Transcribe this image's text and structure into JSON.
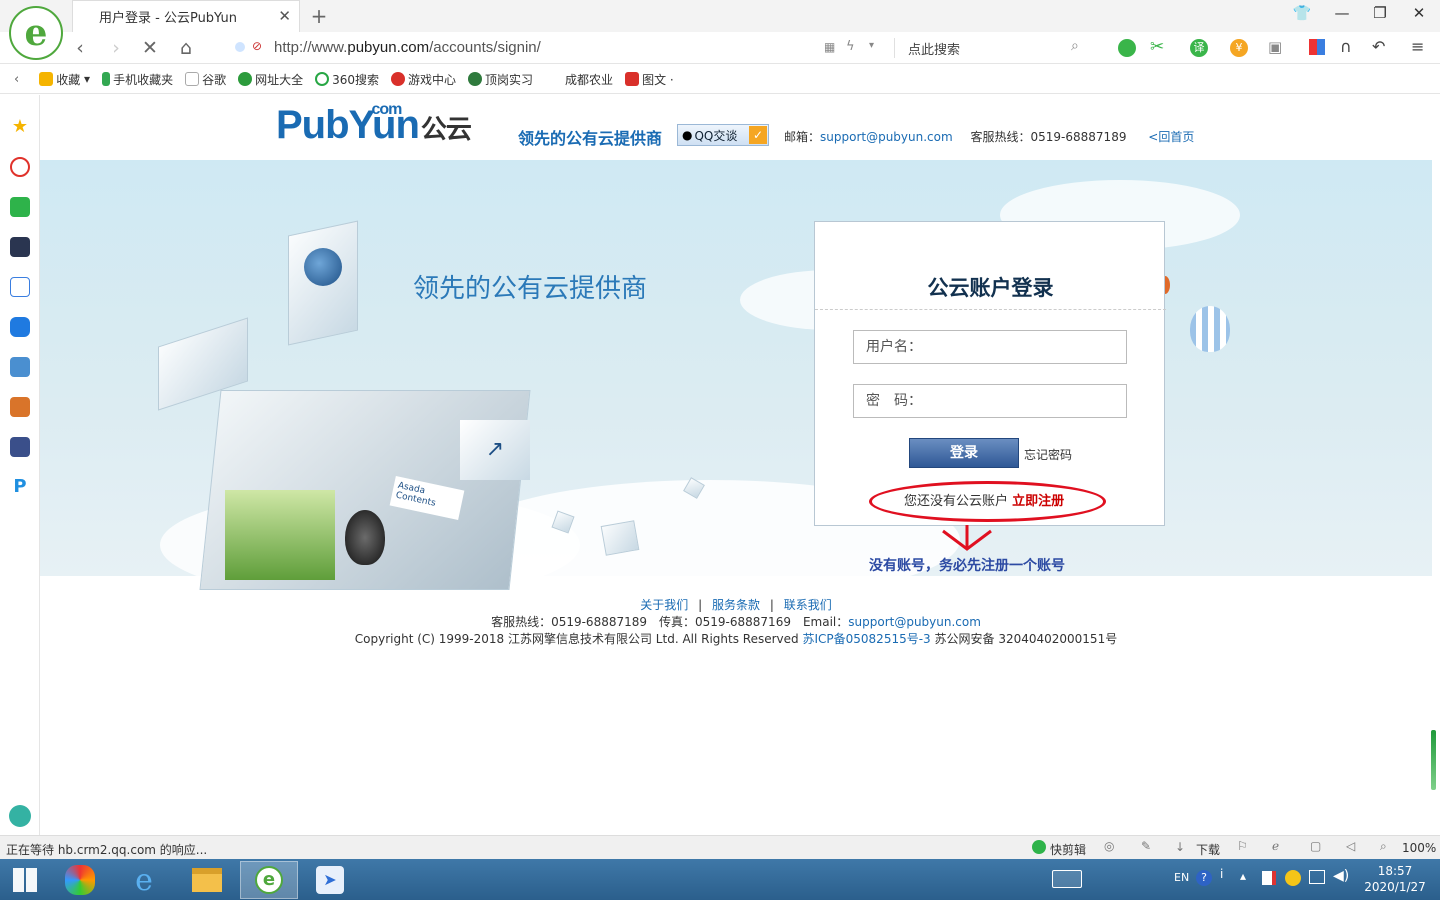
{
  "browser": {
    "tab_title": "用户登录 - 公云PubYun",
    "tab_close": "✕",
    "new_tab": "+",
    "url_prefix": "http://www.",
    "url_domain": "pubyun.com",
    "url_path": "/accounts/signin/",
    "search_placeholder": "点此搜索"
  },
  "bookmarks": [
    {
      "label": "收藏",
      "color": "#f5b400"
    },
    {
      "label": "手机收藏夹",
      "color": "#33a852"
    },
    {
      "label": "谷歌",
      "color": "#d0d0d0"
    },
    {
      "label": "网址大全",
      "color": "#2c9b3c"
    },
    {
      "label": "360搜索",
      "color": "#28a745"
    },
    {
      "label": "游戏中心",
      "color": "#d9302a"
    },
    {
      "label": "顶岗实习",
      "color": "#2f7a3d"
    },
    {
      "label": "成都农业",
      "color": "#ffffff"
    },
    {
      "label": "图文 ·",
      "color": "#d9302a"
    }
  ],
  "header": {
    "logo_main": "PubYun",
    "logo_com": ".com",
    "logo_cn": "公云",
    "tagline": "领先的公有云提供商",
    "qq_label": "QQ交谈",
    "email_label": "邮箱：",
    "email": "support@pubyun.com",
    "hotline": "客服热线：0519-68887189",
    "home_link": "<回首页"
  },
  "banner": {
    "title": "领先的公有云提供商",
    "cube_text": "Asada Contents"
  },
  "login": {
    "title": "公云账户登录",
    "username_placeholder": "用户名：",
    "password_placeholder": "密　码：",
    "login_button": "登录",
    "forgot": "忘记密码",
    "no_account": "您还没有公云账户 ",
    "register": "立即注册"
  },
  "annotation": {
    "reminder": "没有账号，务必先注册一个账号",
    "color": "#e01020"
  },
  "footer": {
    "links": [
      "关于我们",
      "服务条款",
      "联系我们"
    ],
    "separator": "|",
    "hotline": "客服热线：0519-68887189　传真：0519-68887169　Email：",
    "email": "support@pubyun.com",
    "copyright": "Copyright (C) 1999-2018 江苏网擎信息技术有限公司 Ltd. All Rights Reserved ",
    "icp": "苏ICP备05082515号-3",
    "police": " 苏公网安备 32040402000151号"
  },
  "statusbar": {
    "status": "正在等待 hb.crm2.qq.com 的响应...",
    "quickclip": "快剪辑",
    "download": "下载",
    "zoom": "100%"
  },
  "taskbar": {
    "lang": "EN",
    "time": "18:57",
    "date": "2020/1/27"
  }
}
